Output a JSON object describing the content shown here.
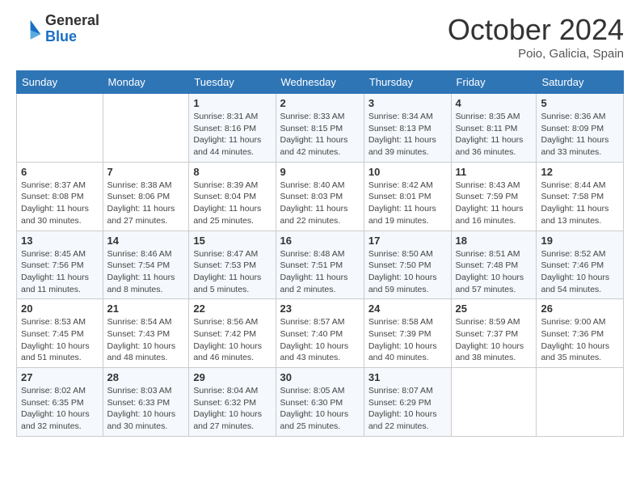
{
  "header": {
    "logo_general": "General",
    "logo_blue": "Blue",
    "month_title": "October 2024",
    "location": "Poio, Galicia, Spain"
  },
  "weekdays": [
    "Sunday",
    "Monday",
    "Tuesday",
    "Wednesday",
    "Thursday",
    "Friday",
    "Saturday"
  ],
  "weeks": [
    [
      {
        "day": "",
        "detail": ""
      },
      {
        "day": "",
        "detail": ""
      },
      {
        "day": "1",
        "detail": "Sunrise: 8:31 AM\nSunset: 8:16 PM\nDaylight: 11 hours and 44 minutes."
      },
      {
        "day": "2",
        "detail": "Sunrise: 8:33 AM\nSunset: 8:15 PM\nDaylight: 11 hours and 42 minutes."
      },
      {
        "day": "3",
        "detail": "Sunrise: 8:34 AM\nSunset: 8:13 PM\nDaylight: 11 hours and 39 minutes."
      },
      {
        "day": "4",
        "detail": "Sunrise: 8:35 AM\nSunset: 8:11 PM\nDaylight: 11 hours and 36 minutes."
      },
      {
        "day": "5",
        "detail": "Sunrise: 8:36 AM\nSunset: 8:09 PM\nDaylight: 11 hours and 33 minutes."
      }
    ],
    [
      {
        "day": "6",
        "detail": "Sunrise: 8:37 AM\nSunset: 8:08 PM\nDaylight: 11 hours and 30 minutes."
      },
      {
        "day": "7",
        "detail": "Sunrise: 8:38 AM\nSunset: 8:06 PM\nDaylight: 11 hours and 27 minutes."
      },
      {
        "day": "8",
        "detail": "Sunrise: 8:39 AM\nSunset: 8:04 PM\nDaylight: 11 hours and 25 minutes."
      },
      {
        "day": "9",
        "detail": "Sunrise: 8:40 AM\nSunset: 8:03 PM\nDaylight: 11 hours and 22 minutes."
      },
      {
        "day": "10",
        "detail": "Sunrise: 8:42 AM\nSunset: 8:01 PM\nDaylight: 11 hours and 19 minutes."
      },
      {
        "day": "11",
        "detail": "Sunrise: 8:43 AM\nSunset: 7:59 PM\nDaylight: 11 hours and 16 minutes."
      },
      {
        "day": "12",
        "detail": "Sunrise: 8:44 AM\nSunset: 7:58 PM\nDaylight: 11 hours and 13 minutes."
      }
    ],
    [
      {
        "day": "13",
        "detail": "Sunrise: 8:45 AM\nSunset: 7:56 PM\nDaylight: 11 hours and 11 minutes."
      },
      {
        "day": "14",
        "detail": "Sunrise: 8:46 AM\nSunset: 7:54 PM\nDaylight: 11 hours and 8 minutes."
      },
      {
        "day": "15",
        "detail": "Sunrise: 8:47 AM\nSunset: 7:53 PM\nDaylight: 11 hours and 5 minutes."
      },
      {
        "day": "16",
        "detail": "Sunrise: 8:48 AM\nSunset: 7:51 PM\nDaylight: 11 hours and 2 minutes."
      },
      {
        "day": "17",
        "detail": "Sunrise: 8:50 AM\nSunset: 7:50 PM\nDaylight: 10 hours and 59 minutes."
      },
      {
        "day": "18",
        "detail": "Sunrise: 8:51 AM\nSunset: 7:48 PM\nDaylight: 10 hours and 57 minutes."
      },
      {
        "day": "19",
        "detail": "Sunrise: 8:52 AM\nSunset: 7:46 PM\nDaylight: 10 hours and 54 minutes."
      }
    ],
    [
      {
        "day": "20",
        "detail": "Sunrise: 8:53 AM\nSunset: 7:45 PM\nDaylight: 10 hours and 51 minutes."
      },
      {
        "day": "21",
        "detail": "Sunrise: 8:54 AM\nSunset: 7:43 PM\nDaylight: 10 hours and 48 minutes."
      },
      {
        "day": "22",
        "detail": "Sunrise: 8:56 AM\nSunset: 7:42 PM\nDaylight: 10 hours and 46 minutes."
      },
      {
        "day": "23",
        "detail": "Sunrise: 8:57 AM\nSunset: 7:40 PM\nDaylight: 10 hours and 43 minutes."
      },
      {
        "day": "24",
        "detail": "Sunrise: 8:58 AM\nSunset: 7:39 PM\nDaylight: 10 hours and 40 minutes."
      },
      {
        "day": "25",
        "detail": "Sunrise: 8:59 AM\nSunset: 7:37 PM\nDaylight: 10 hours and 38 minutes."
      },
      {
        "day": "26",
        "detail": "Sunrise: 9:00 AM\nSunset: 7:36 PM\nDaylight: 10 hours and 35 minutes."
      }
    ],
    [
      {
        "day": "27",
        "detail": "Sunrise: 8:02 AM\nSunset: 6:35 PM\nDaylight: 10 hours and 32 minutes."
      },
      {
        "day": "28",
        "detail": "Sunrise: 8:03 AM\nSunset: 6:33 PM\nDaylight: 10 hours and 30 minutes."
      },
      {
        "day": "29",
        "detail": "Sunrise: 8:04 AM\nSunset: 6:32 PM\nDaylight: 10 hours and 27 minutes."
      },
      {
        "day": "30",
        "detail": "Sunrise: 8:05 AM\nSunset: 6:30 PM\nDaylight: 10 hours and 25 minutes."
      },
      {
        "day": "31",
        "detail": "Sunrise: 8:07 AM\nSunset: 6:29 PM\nDaylight: 10 hours and 22 minutes."
      },
      {
        "day": "",
        "detail": ""
      },
      {
        "day": "",
        "detail": ""
      }
    ]
  ]
}
